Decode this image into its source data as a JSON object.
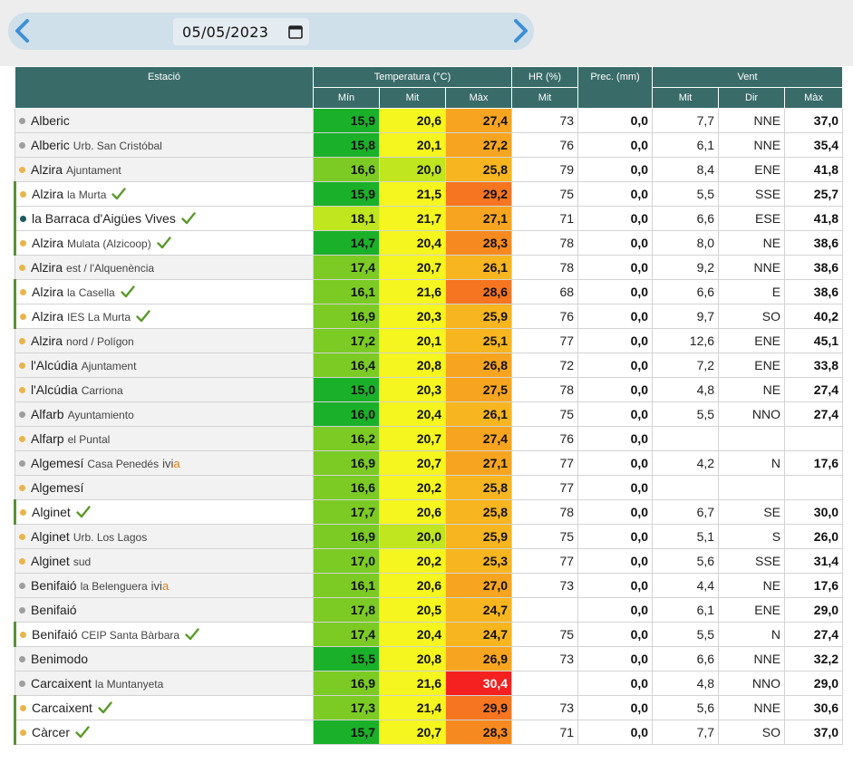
{
  "nav": {
    "date": "05/05/2023",
    "prev_icon": "chevron-left-icon",
    "next_icon": "chevron-right-icon",
    "calendar_icon": "calendar-icon"
  },
  "headers": {
    "station": "Estació",
    "temp": "Temperatura (°C)",
    "hr": "HR (%)",
    "prec": "Prec. (mm)",
    "wind": "Vent",
    "min": "Mín",
    "mit": "Mit",
    "max": "Màx",
    "hr_mit": "Mit",
    "wind_mit": "Mit",
    "wind_dir": "Dir",
    "wind_max": "Màx"
  },
  "colors": {
    "header": "#396b69",
    "check": "#5a9a2a",
    "dot_gray": "#9e9e9e",
    "dot_yellow": "#e9b54a",
    "dot_teal": "#1d5a63"
  },
  "rows": [
    {
      "name": "Alberic",
      "sub": "",
      "ivi": false,
      "check": false,
      "dot": "gray",
      "bar": false,
      "min": "15,9",
      "mit": "20,6",
      "max": "27,4",
      "hr": "73",
      "prec": "0,0",
      "wmit": "7,7",
      "dir": "NNE",
      "wmax": "37,0",
      "cmin": "#1bb02a",
      "cmit": "#f5f51f",
      "cmax": "#f7a520"
    },
    {
      "name": "Alberic",
      "sub": "Urb. San Cristóbal",
      "ivi": false,
      "check": false,
      "dot": "gray",
      "bar": false,
      "min": "15,8",
      "mit": "20,1",
      "max": "27,2",
      "hr": "76",
      "prec": "0,0",
      "wmit": "6,1",
      "dir": "NNE",
      "wmax": "35,4",
      "cmin": "#1bb02a",
      "cmit": "#f5f51f",
      "cmax": "#f7a520"
    },
    {
      "name": "Alzira",
      "sub": "Ajuntament",
      "ivi": false,
      "check": false,
      "dot": "yellow",
      "bar": false,
      "min": "16,6",
      "mit": "20,0",
      "max": "25,8",
      "hr": "79",
      "prec": "0,0",
      "wmit": "8,4",
      "dir": "ENE",
      "wmax": "41,8",
      "cmin": "#7ccb25",
      "cmit": "#bfe61e",
      "cmax": "#f7b520"
    },
    {
      "name": "Alzira",
      "sub": "la Murta",
      "ivi": false,
      "check": true,
      "dot": "yellow",
      "bar": true,
      "min": "15,9",
      "mit": "21,5",
      "max": "29,2",
      "hr": "75",
      "prec": "0,0",
      "wmit": "5,5",
      "dir": "SSE",
      "wmax": "25,7",
      "cmin": "#1bb02a",
      "cmit": "#f5f51f",
      "cmax": "#f67520"
    },
    {
      "name": "la Barraca d'Aigües Vives",
      "sub": "",
      "ivi": false,
      "check": true,
      "dot": "teal",
      "bar": true,
      "min": "18,1",
      "mit": "21,7",
      "max": "27,1",
      "hr": "71",
      "prec": "0,0",
      "wmit": "6,6",
      "dir": "ESE",
      "wmax": "41,8",
      "cmin": "#bfe61e",
      "cmit": "#f5f51f",
      "cmax": "#f7a520"
    },
    {
      "name": "Alzira",
      "sub": "Mulata (Alzicoop)",
      "ivi": false,
      "check": true,
      "dot": "yellow",
      "bar": true,
      "min": "14,7",
      "mit": "20,4",
      "max": "28,3",
      "hr": "78",
      "prec": "0,0",
      "wmit": "8,0",
      "dir": "NE",
      "wmax": "38,6",
      "cmin": "#1bb02a",
      "cmit": "#f5f51f",
      "cmax": "#f68a20"
    },
    {
      "name": "Alzira",
      "sub": "est / l'Alquenència",
      "ivi": false,
      "check": false,
      "dot": "yellow",
      "bar": false,
      "min": "17,4",
      "mit": "20,7",
      "max": "26,1",
      "hr": "78",
      "prec": "0,0",
      "wmit": "9,2",
      "dir": "NNE",
      "wmax": "38,6",
      "cmin": "#7ccb25",
      "cmit": "#f5f51f",
      "cmax": "#f7b520"
    },
    {
      "name": "Alzira",
      "sub": "la Casella",
      "ivi": false,
      "check": true,
      "dot": "yellow",
      "bar": true,
      "min": "16,1",
      "mit": "21,6",
      "max": "28,6",
      "hr": "68",
      "prec": "0,0",
      "wmit": "6,6",
      "dir": "E",
      "wmax": "38,6",
      "cmin": "#7ccb25",
      "cmit": "#f5f51f",
      "cmax": "#f67520"
    },
    {
      "name": "Alzira",
      "sub": "IES La Murta",
      "ivi": false,
      "check": true,
      "dot": "yellow",
      "bar": true,
      "min": "16,9",
      "mit": "20,3",
      "max": "25,9",
      "hr": "76",
      "prec": "0,0",
      "wmit": "9,7",
      "dir": "SO",
      "wmax": "40,2",
      "cmin": "#7ccb25",
      "cmit": "#f5f51f",
      "cmax": "#f7b520"
    },
    {
      "name": "Alzira",
      "sub": "nord / Polígon",
      "ivi": false,
      "check": false,
      "dot": "yellow",
      "bar": false,
      "min": "17,2",
      "mit": "20,1",
      "max": "25,1",
      "hr": "77",
      "prec": "0,0",
      "wmit": "12,6",
      "dir": "ENE",
      "wmax": "45,1",
      "cmin": "#7ccb25",
      "cmit": "#f5f51f",
      "cmax": "#f7b520"
    },
    {
      "name": "l'Alcúdia",
      "sub": "Ajuntament",
      "ivi": false,
      "check": false,
      "dot": "yellow",
      "bar": false,
      "min": "16,4",
      "mit": "20,8",
      "max": "26,8",
      "hr": "72",
      "prec": "0,0",
      "wmit": "7,2",
      "dir": "ENE",
      "wmax": "33,8",
      "cmin": "#7ccb25",
      "cmit": "#f5f51f",
      "cmax": "#f7a520"
    },
    {
      "name": "l'Alcúdia",
      "sub": "Carriona",
      "ivi": false,
      "check": false,
      "dot": "yellow",
      "bar": false,
      "min": "15,0",
      "mit": "20,3",
      "max": "27,5",
      "hr": "78",
      "prec": "0,0",
      "wmit": "4,8",
      "dir": "NE",
      "wmax": "27,4",
      "cmin": "#1bb02a",
      "cmit": "#f5f51f",
      "cmax": "#f7a520"
    },
    {
      "name": "Alfarb",
      "sub": "Ayuntamiento",
      "ivi": false,
      "check": false,
      "dot": "gray",
      "bar": false,
      "min": "16,0",
      "mit": "20,4",
      "max": "26,1",
      "hr": "75",
      "prec": "0,0",
      "wmit": "5,5",
      "dir": "NNO",
      "wmax": "27,4",
      "cmin": "#1bb02a",
      "cmit": "#f5f51f",
      "cmax": "#f7b520"
    },
    {
      "name": "Alfarp",
      "sub": "el Puntal",
      "ivi": false,
      "check": false,
      "dot": "yellow",
      "bar": false,
      "min": "16,2",
      "mit": "20,7",
      "max": "27,4",
      "hr": "76",
      "prec": "0,0",
      "wmit": "",
      "dir": "",
      "wmax": "",
      "cmin": "#7ccb25",
      "cmit": "#f5f51f",
      "cmax": "#f7a520"
    },
    {
      "name": "Algemesí",
      "sub": "Casa Penedés",
      "ivi": true,
      "check": false,
      "dot": "gray",
      "bar": false,
      "min": "16,9",
      "mit": "20,7",
      "max": "27,1",
      "hr": "77",
      "prec": "0,0",
      "wmit": "4,2",
      "dir": "N",
      "wmax": "17,6",
      "cmin": "#7ccb25",
      "cmit": "#f5f51f",
      "cmax": "#f7a520"
    },
    {
      "name": "Algemesí",
      "sub": "",
      "ivi": false,
      "check": false,
      "dot": "yellow",
      "bar": false,
      "min": "16,6",
      "mit": "20,2",
      "max": "25,8",
      "hr": "77",
      "prec": "0,0",
      "wmit": "",
      "dir": "",
      "wmax": "",
      "cmin": "#7ccb25",
      "cmit": "#f5f51f",
      "cmax": "#f7b520"
    },
    {
      "name": "Alginet",
      "sub": "",
      "ivi": false,
      "check": true,
      "dot": "yellow",
      "bar": true,
      "min": "17,7",
      "mit": "20,6",
      "max": "25,8",
      "hr": "78",
      "prec": "0,0",
      "wmit": "6,7",
      "dir": "SE",
      "wmax": "30,0",
      "cmin": "#7ccb25",
      "cmit": "#f5f51f",
      "cmax": "#f7b520"
    },
    {
      "name": "Alginet",
      "sub": "Urb. Los Lagos",
      "ivi": false,
      "check": false,
      "dot": "yellow",
      "bar": false,
      "min": "16,9",
      "mit": "20,0",
      "max": "25,9",
      "hr": "75",
      "prec": "0,0",
      "wmit": "5,1",
      "dir": "S",
      "wmax": "26,0",
      "cmin": "#7ccb25",
      "cmit": "#bfe61e",
      "cmax": "#f7b520"
    },
    {
      "name": "Alginet",
      "sub": "sud",
      "ivi": false,
      "check": false,
      "dot": "yellow",
      "bar": false,
      "min": "17,0",
      "mit": "20,2",
      "max": "25,3",
      "hr": "77",
      "prec": "0,0",
      "wmit": "5,6",
      "dir": "SSE",
      "wmax": "31,4",
      "cmin": "#7ccb25",
      "cmit": "#f5f51f",
      "cmax": "#f7b520"
    },
    {
      "name": "Benifaió",
      "sub": "la Belenguera",
      "ivi": true,
      "check": false,
      "dot": "gray",
      "bar": false,
      "min": "16,1",
      "mit": "20,6",
      "max": "27,0",
      "hr": "73",
      "prec": "0,0",
      "wmit": "4,4",
      "dir": "NE",
      "wmax": "17,6",
      "cmin": "#7ccb25",
      "cmit": "#f5f51f",
      "cmax": "#f7a520"
    },
    {
      "name": "Benifaió",
      "sub": "",
      "ivi": false,
      "check": false,
      "dot": "gray",
      "bar": false,
      "min": "17,8",
      "mit": "20,5",
      "max": "24,7",
      "hr": "",
      "prec": "0,0",
      "wmit": "6,1",
      "dir": "ENE",
      "wmax": "29,0",
      "cmin": "#7ccb25",
      "cmit": "#f5f51f",
      "cmax": "#f7b520"
    },
    {
      "name": "Benifaió",
      "sub": "CEIP Santa Bàrbara",
      "ivi": false,
      "check": true,
      "dot": "yellow",
      "bar": true,
      "min": "17,4",
      "mit": "20,4",
      "max": "24,7",
      "hr": "75",
      "prec": "0,0",
      "wmit": "5,5",
      "dir": "N",
      "wmax": "27,4",
      "cmin": "#7ccb25",
      "cmit": "#f5f51f",
      "cmax": "#f7b520"
    },
    {
      "name": "Benimodo",
      "sub": "",
      "ivi": false,
      "check": false,
      "dot": "gray",
      "bar": false,
      "min": "15,5",
      "mit": "20,8",
      "max": "26,9",
      "hr": "73",
      "prec": "0,0",
      "wmit": "6,6",
      "dir": "NNE",
      "wmax": "32,2",
      "cmin": "#1bb02a",
      "cmit": "#f5f51f",
      "cmax": "#f7a520"
    },
    {
      "name": "Carcaixent",
      "sub": "la Muntanyeta",
      "ivi": false,
      "check": false,
      "dot": "gray",
      "bar": false,
      "min": "16,9",
      "mit": "21,6",
      "max": "30,4",
      "hr": "",
      "prec": "0,0",
      "wmit": "4,8",
      "dir": "NNO",
      "wmax": "29,0",
      "cmin": "#7ccb25",
      "cmit": "#f5f51f",
      "cmax": "#f52020",
      "hot": true
    },
    {
      "name": "Carcaixent",
      "sub": "",
      "ivi": false,
      "check": true,
      "dot": "yellow",
      "bar": true,
      "min": "17,3",
      "mit": "21,4",
      "max": "29,9",
      "hr": "73",
      "prec": "0,0",
      "wmit": "5,6",
      "dir": "NNE",
      "wmax": "30,6",
      "cmin": "#7ccb25",
      "cmit": "#f5f51f",
      "cmax": "#f67520"
    },
    {
      "name": "Càrcer",
      "sub": "",
      "ivi": false,
      "check": true,
      "dot": "yellow",
      "bar": true,
      "min": "15,7",
      "mit": "20,7",
      "max": "28,3",
      "hr": "71",
      "prec": "0,0",
      "wmit": "7,7",
      "dir": "SO",
      "wmax": "37,0",
      "cmin": "#1bb02a",
      "cmit": "#f5f51f",
      "cmax": "#f68a20"
    }
  ]
}
